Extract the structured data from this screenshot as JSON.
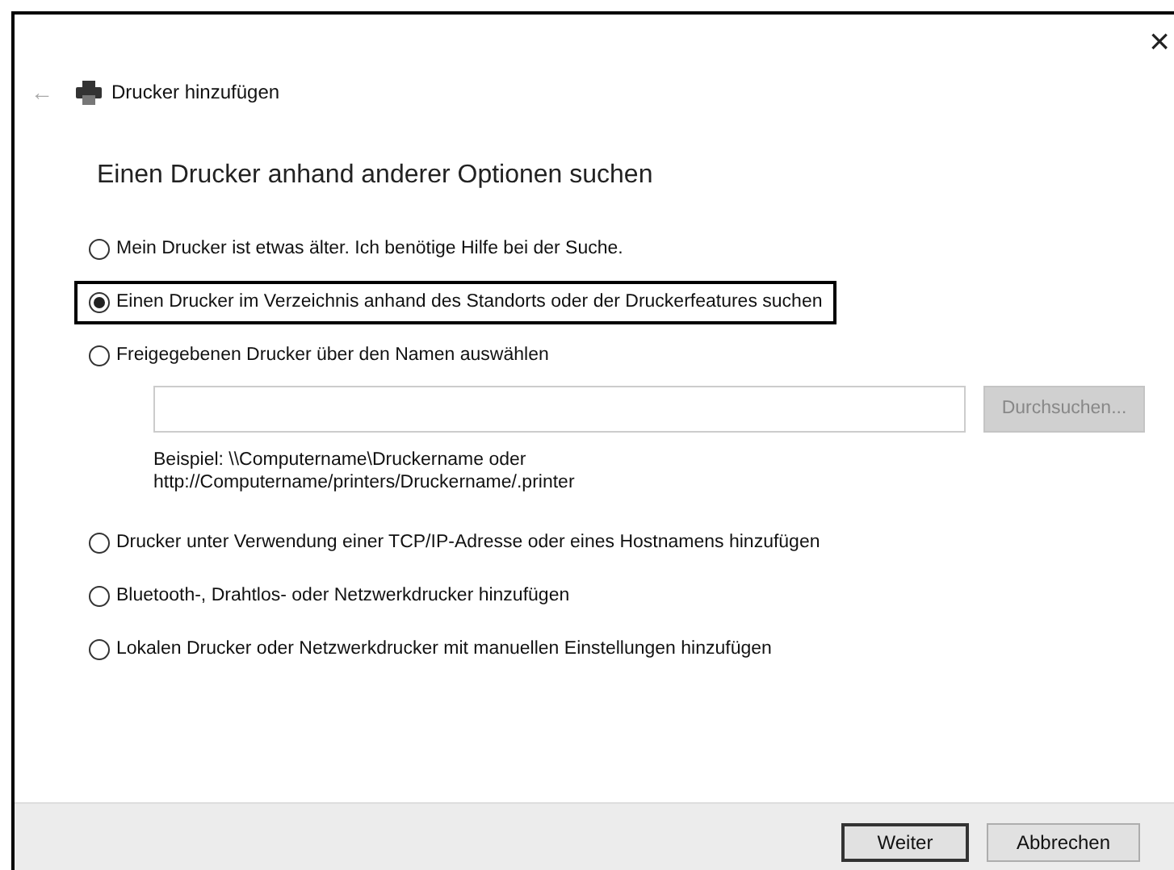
{
  "window": {
    "close": "×"
  },
  "header": {
    "back": "←",
    "title": "Drucker hinzufügen"
  },
  "heading": "Einen Drucker anhand anderer Optionen suchen",
  "options": [
    {
      "label": "Mein Drucker ist etwas älter. Ich benötige Hilfe bei der Suche.",
      "selected": false,
      "focused": false
    },
    {
      "label": "Einen Drucker im Verzeichnis anhand des Standorts oder der Druckerfeatures suchen",
      "selected": true,
      "focused": true
    },
    {
      "label": "Freigegebenen Drucker über den Namen auswählen",
      "selected": false,
      "focused": false,
      "share": {
        "browse_button": {
          "label": "Durchsuchen...",
          "disabled": true
        },
        "example_lines": [
          "Beispiel: \\\\Computername\\Druckername oder",
          "http://Computername/printers/Druckername/.printer"
        ]
      }
    },
    {
      "label": "Drucker unter Verwendung einer TCP/IP-Adresse oder eines Hostnamens hinzufügen",
      "selected": false,
      "focused": false
    },
    {
      "label": "Bluetooth-, Drahtlos- oder Netzwerkdrucker hinzufügen",
      "selected": false,
      "focused": false
    },
    {
      "label": "Lokalen Drucker oder Netzwerkdrucker mit manuellen Einstellungen hinzufügen",
      "selected": false,
      "focused": false
    }
  ],
  "buttons": [
    {
      "label": "Weiter",
      "default": true
    },
    {
      "label": "Abbrechen",
      "default": false
    }
  ]
}
